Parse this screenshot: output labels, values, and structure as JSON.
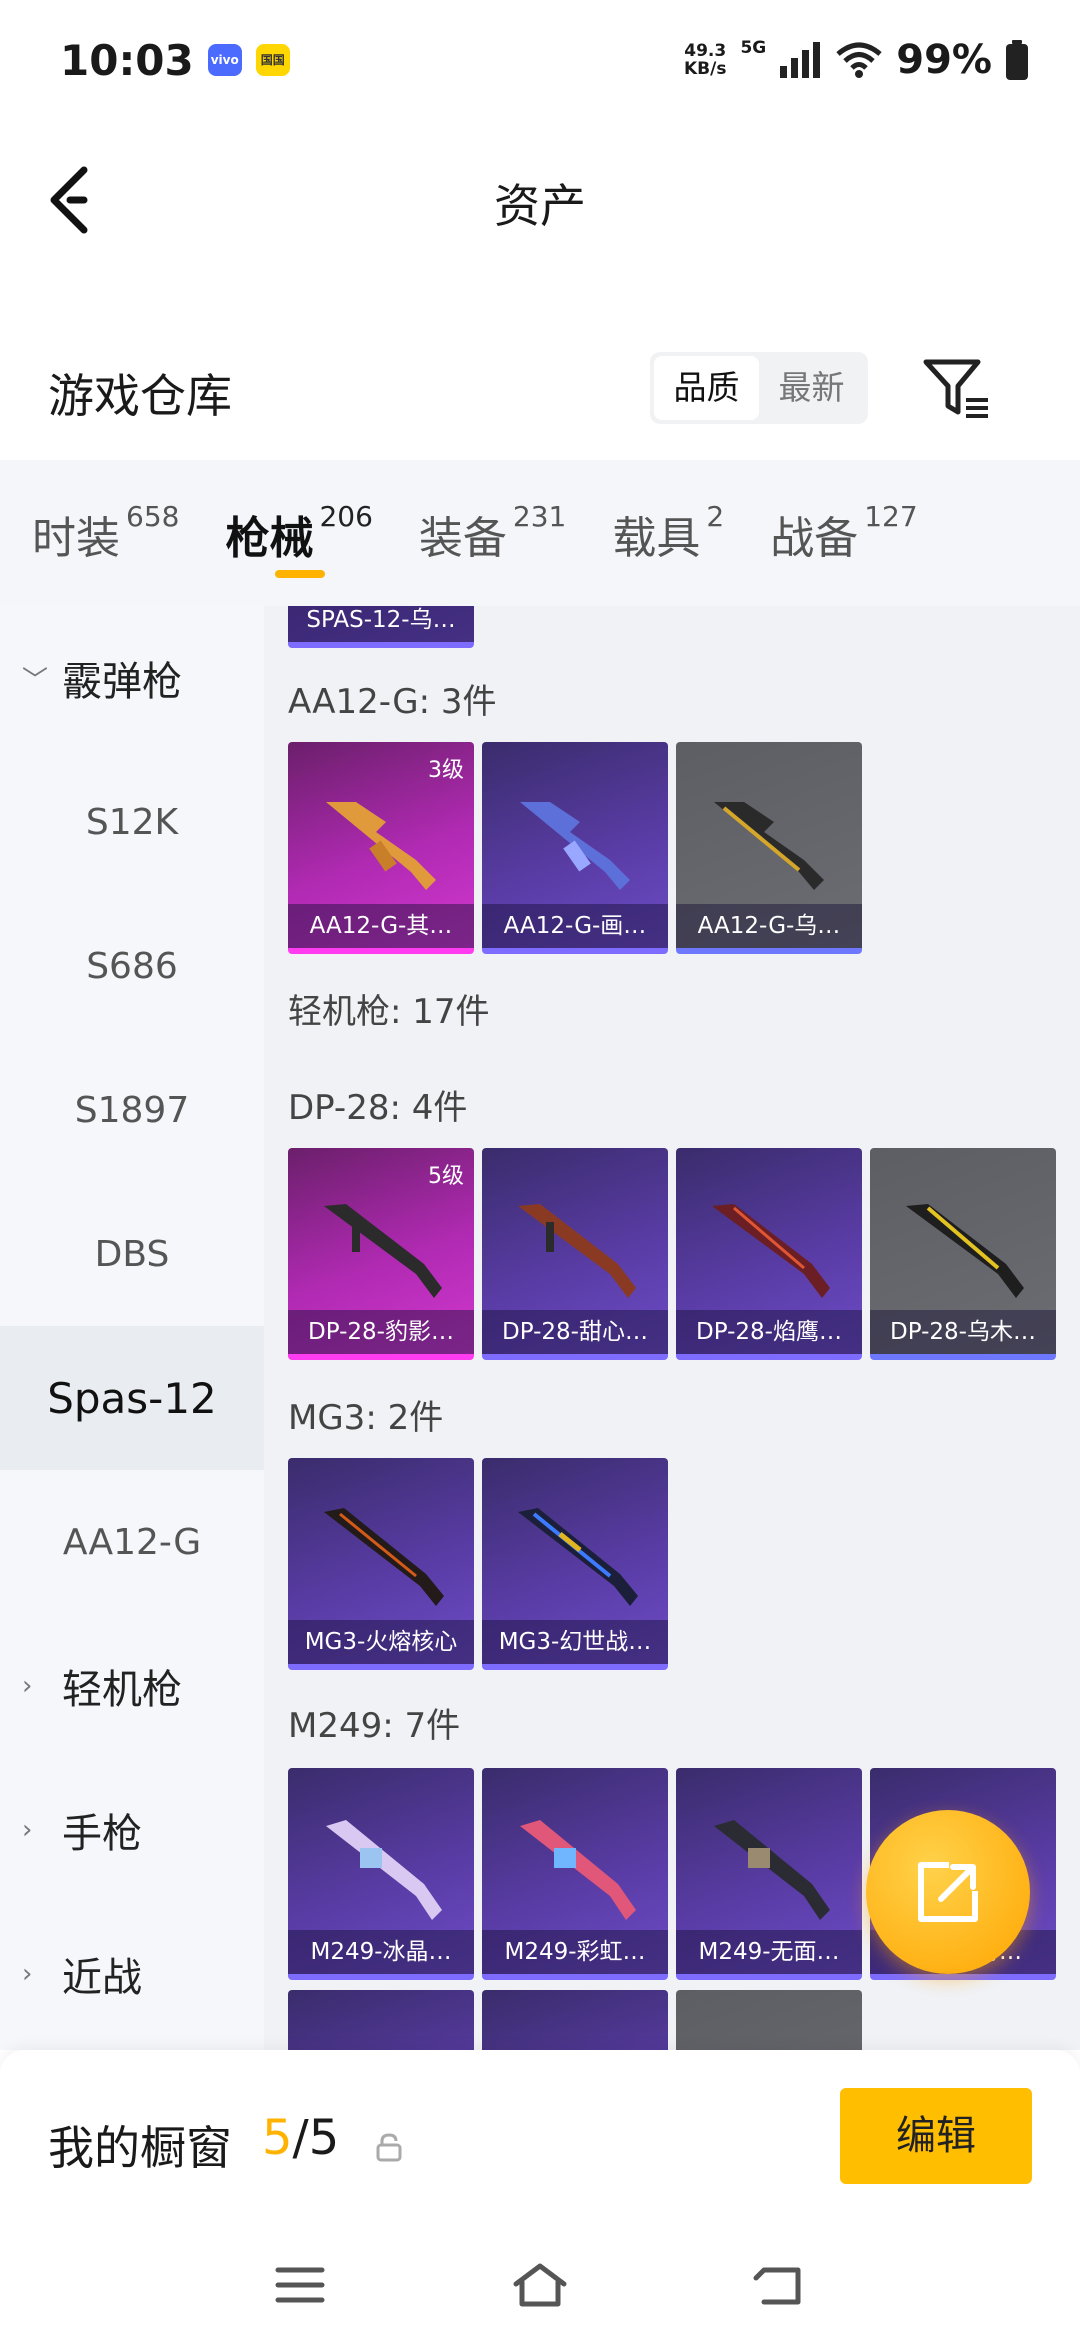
{
  "status": {
    "time": "10:03",
    "badge1": "vivo",
    "badge2": "国国",
    "net_speed_value": "49.3",
    "net_speed_unit": "KB/s",
    "network": "5G",
    "battery": "99%"
  },
  "nav": {
    "title": "资产"
  },
  "warehouse": {
    "title": "游戏仓库",
    "sort_quality": "品质",
    "sort_latest": "最新"
  },
  "tabs": [
    {
      "label": "时装",
      "count": "658"
    },
    {
      "label": "枪械",
      "count": "206"
    },
    {
      "label": "装备",
      "count": "231"
    },
    {
      "label": "载具",
      "count": "2"
    },
    {
      "label": "战备",
      "count": "127"
    }
  ],
  "sidebar": [
    {
      "label": "霰弹枪"
    },
    {
      "label": "S12K"
    },
    {
      "label": "S686"
    },
    {
      "label": "S1897"
    },
    {
      "label": "DBS"
    },
    {
      "label": "Spas-12"
    },
    {
      "label": "AA12-G"
    },
    {
      "label": "轻机枪"
    },
    {
      "label": "手枪"
    },
    {
      "label": "近战"
    }
  ],
  "content": {
    "top_card": "SPAS-12-乌…",
    "aa12_header": "AA12-G: 3件",
    "aa12": [
      {
        "name": "AA12-G-其…",
        "level": "3级"
      },
      {
        "name": "AA12-G-画…"
      },
      {
        "name": "AA12-G-乌…"
      }
    ],
    "lmg_header": "轻机枪: 17件",
    "dp28_header": "DP-28: 4件",
    "dp28": [
      {
        "name": "DP-28-豹影…",
        "level": "5级"
      },
      {
        "name": "DP-28-甜心…"
      },
      {
        "name": "DP-28-焰鹰…"
      },
      {
        "name": "DP-28-乌木…"
      }
    ],
    "mg3_header": "MG3: 2件",
    "mg3": [
      {
        "name": "MG3-火熔核心"
      },
      {
        "name": "MG3-幻世战…"
      }
    ],
    "m249_header": "M249: 7件",
    "m249": [
      {
        "name": "M249-冰晶…"
      },
      {
        "name": "M249-彩虹…"
      },
      {
        "name": "M249-无面…"
      },
      {
        "name": "M249-穹…"
      }
    ]
  },
  "showcase": {
    "title": "我的橱窗",
    "current": "5",
    "separator": "/",
    "total": "5",
    "edit_label": "编辑"
  }
}
